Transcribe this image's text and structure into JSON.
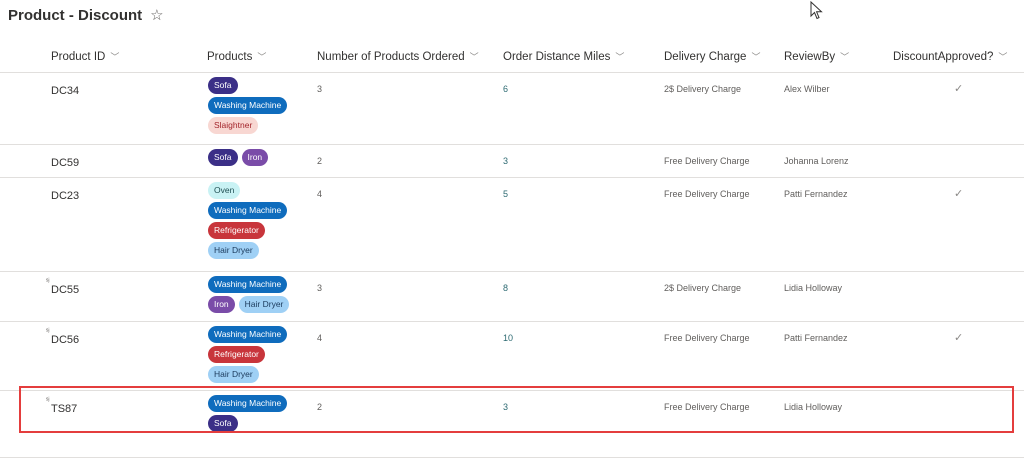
{
  "page": {
    "title": "Product - Discount",
    "star_icon": "star-outline-icon"
  },
  "colors": {
    "highlight": "#e43d3d",
    "pill_navy": "#3b2f87",
    "pill_blue": "#0f6cbd",
    "pill_pink": "#f8d7d2",
    "pill_purple": "#7a4ca8",
    "pill_lightblue": "#9fd0f5",
    "pill_red": "#c8353b",
    "pill_cyan": "#c9f2f4"
  },
  "columns": [
    {
      "label": "Product ID"
    },
    {
      "label": "Products"
    },
    {
      "label": "Number of Products Ordered"
    },
    {
      "label": "Order Distance Miles"
    },
    {
      "label": "Delivery Charge"
    },
    {
      "label": "ReviewBy"
    },
    {
      "label": "DiscountApproved?"
    }
  ],
  "rows": [
    {
      "id": "DC34",
      "new": false,
      "products": [
        {
          "label": "Sofa",
          "color": "navy"
        },
        {
          "label": "Washing Machine",
          "color": "blue"
        },
        {
          "label": "Slaightner",
          "color": "pink"
        }
      ],
      "ordered": "3",
      "miles": "6",
      "delivery": "2$ Delivery Charge",
      "review": "Alex Wilber",
      "approved": true
    },
    {
      "id": "DC59",
      "new": false,
      "products": [
        {
          "label": "Sofa",
          "color": "navy"
        },
        {
          "label": "Iron",
          "color": "purple"
        }
      ],
      "ordered": "2",
      "miles": "3",
      "delivery": "Free Delivery Charge",
      "review": "Johanna Lorenz",
      "approved": false
    },
    {
      "id": "DC23",
      "new": false,
      "products": [
        {
          "label": "Oven",
          "color": "cyan"
        },
        {
          "label": "Washing Machine",
          "color": "blue"
        },
        {
          "label": "Refrigerator",
          "color": "red"
        },
        {
          "label": "Hair Dryer",
          "color": "lightblue"
        }
      ],
      "ordered": "4",
      "miles": "5",
      "delivery": "Free Delivery Charge",
      "review": "Patti Fernandez",
      "approved": true
    },
    {
      "id": "DC55",
      "new": true,
      "products": [
        {
          "label": "Washing Machine",
          "color": "blue"
        },
        {
          "label": "Iron",
          "color": "purple"
        },
        {
          "label": "Hair Dryer",
          "color": "lightblue"
        }
      ],
      "ordered": "3",
      "miles": "8",
      "delivery": "2$ Delivery Charge",
      "review": "Lidia Holloway",
      "approved": false
    },
    {
      "id": "DC56",
      "new": true,
      "products": [
        {
          "label": "Washing Machine",
          "color": "blue"
        },
        {
          "label": "Refrigerator",
          "color": "red"
        },
        {
          "label": "Hair Dryer",
          "color": "lightblue"
        }
      ],
      "ordered": "4",
      "miles": "10",
      "delivery": "Free Delivery Charge",
      "review": "Patti Fernandez",
      "approved": true
    },
    {
      "id": "TS87",
      "new": true,
      "products": [
        {
          "label": "Washing Machine",
          "color": "blue"
        },
        {
          "label": "Sofa",
          "color": "navy"
        }
      ],
      "ordered": "2",
      "miles": "3",
      "delivery": "Free Delivery Charge",
      "review": "Lidia Holloway",
      "approved": false
    }
  ],
  "new_item_mark": "ˢʲ",
  "check_glyph": "✓"
}
